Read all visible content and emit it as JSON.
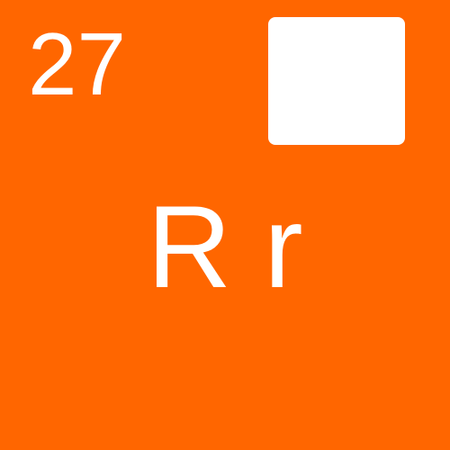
{
  "card": {
    "number": "27",
    "letters": "R r",
    "background_color": "#ff6600",
    "foreground_color": "#ffffff"
  }
}
